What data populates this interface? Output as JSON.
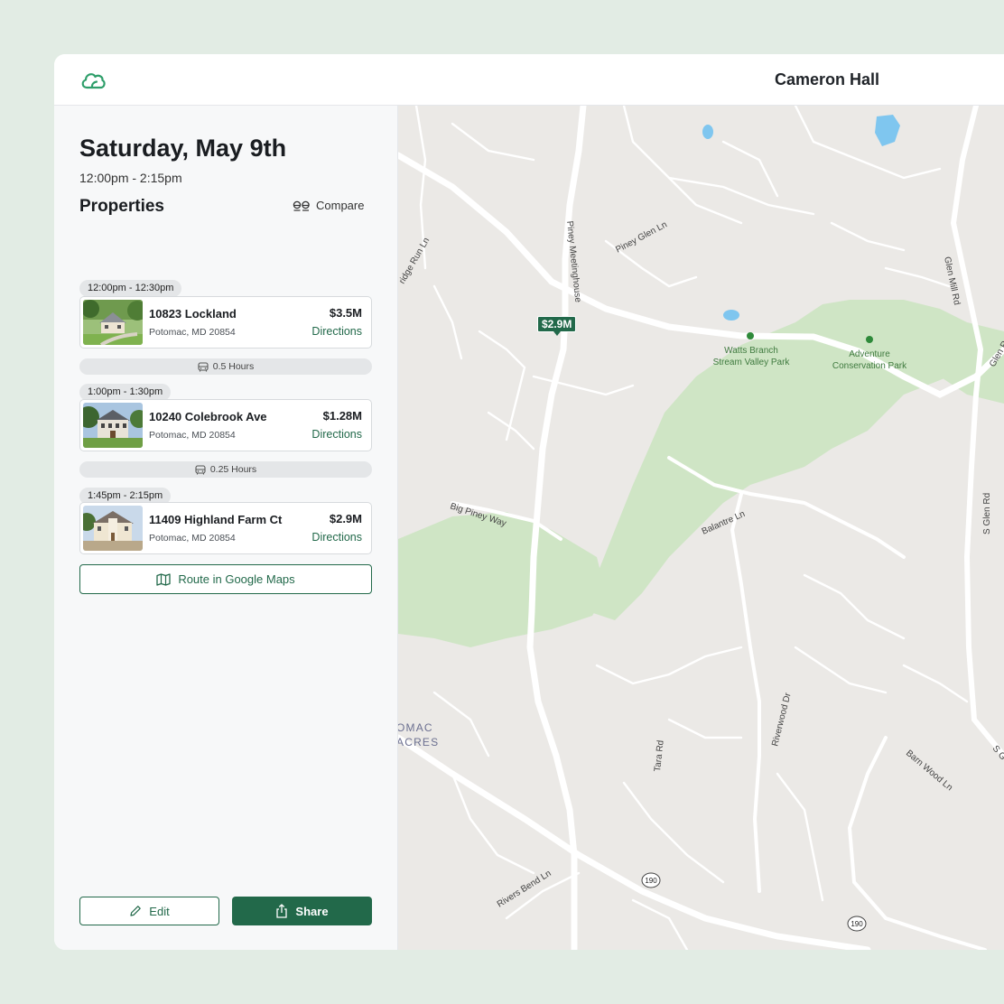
{
  "header": {
    "user_name": "Cameron Hall",
    "logo": "cloud-logo-icon"
  },
  "tour": {
    "date": "Saturday, May 9th",
    "time_range": "12:00pm - 2:15pm",
    "properties_heading": "Properties",
    "compare_label": "Compare"
  },
  "properties": [
    {
      "slot": "12:00pm - 12:30pm",
      "address": "10823 Lockland",
      "city": "Potomac, MD 20854",
      "price": "$3.5M",
      "directions": "Directions"
    },
    {
      "slot": "1:00pm - 1:30pm",
      "address": "10240 Colebrook Ave",
      "city": "Potomac, MD 20854",
      "price": "$1.28M",
      "directions": "Directions"
    },
    {
      "slot": "1:45pm - 2:15pm",
      "address": "11409 Highland Farm Ct",
      "city": "Potomac, MD 20854",
      "price": "$2.9M",
      "directions": "Directions"
    }
  ],
  "drives": [
    "0.5 Hours",
    "0.25 Hours"
  ],
  "actions": {
    "route_label": "Route in Google Maps",
    "edit_label": "Edit",
    "share_label": "Share"
  },
  "map": {
    "pin_price": "$2.9M",
    "roads": {
      "piney_meetinghouse": "Piney Meetinghouse",
      "piney_glen": "Piney Glen Ln",
      "glen_mill": "Glen Mill Rd",
      "ridge_run": "ridge Run Ln",
      "big_piney": "Big Piney Way",
      "balantre": "Balantre Ln",
      "s_glen": "S Glen Rd",
      "riverwood": "Riverwood Dr",
      "tara": "Tara Rd",
      "barn_wood": "Barn Wood Ln",
      "rivers_bend": "Rivers Bend Ln",
      "glen_r": "Glen R",
      "s_g": "S G",
      "route_190": "190"
    },
    "parks": {
      "watts_1": "Watts Branch",
      "watts_2": "Stream Valley Park",
      "adventure_1": "Adventure",
      "adventure_2": "Conservation Park"
    },
    "area": {
      "line1": "OMAC",
      "line2": "ACRES"
    }
  },
  "colors": {
    "brand_green": "#22694a",
    "page_bg": "#e2ece4",
    "park_green": "#cfe5c5",
    "water": "#7fc6ef"
  }
}
